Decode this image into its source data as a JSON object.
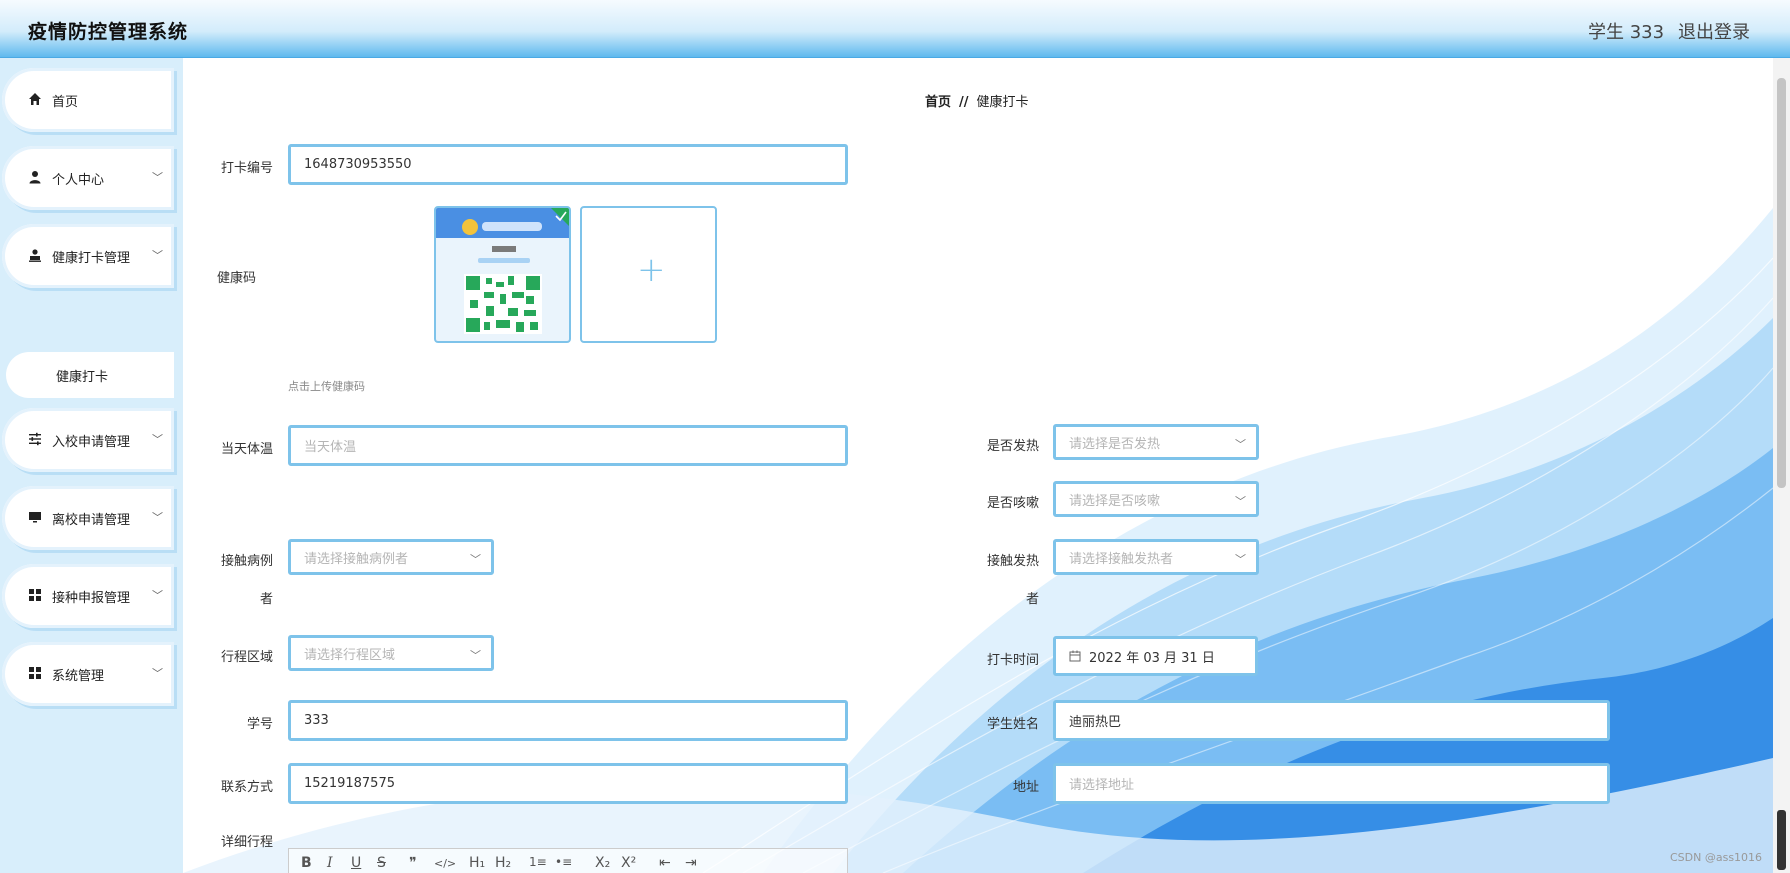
{
  "header": {
    "title": "疫情防控管理系统",
    "user": "学生 333",
    "logout": "退出登录"
  },
  "sidebar": {
    "items": [
      {
        "label": "首页",
        "icon": "home-icon"
      },
      {
        "label": "个人中心",
        "icon": "user-icon",
        "chevron": "﹀"
      },
      {
        "label": "健康打卡管理",
        "icon": "upload-user-icon",
        "chevron": "﹀"
      },
      {
        "label": "入校申请管理",
        "icon": "sliders-icon",
        "chevron": "﹀"
      },
      {
        "label": "离校申请管理",
        "icon": "monitor-icon",
        "chevron": "﹀"
      },
      {
        "label": "接种申报管理",
        "icon": "grid-icon",
        "chevron": "﹀"
      },
      {
        "label": "系统管理",
        "icon": "grid-icon",
        "chevron": "﹀"
      }
    ],
    "sub_item": "健康打卡"
  },
  "breadcrumb": {
    "home": "首页",
    "sep": "//",
    "current": "健康打卡"
  },
  "form": {
    "checkin_no": {
      "label": "打卡编号",
      "value": "1648730953550"
    },
    "health_code": {
      "label": "健康码",
      "hint": "点击上传健康码",
      "plus": "+"
    },
    "temperature": {
      "label": "当天体温",
      "placeholder": "当天体温"
    },
    "fever": {
      "label": "是否发热",
      "placeholder": "请选择是否发热"
    },
    "cough": {
      "label": "是否咳嗽",
      "placeholder": "请选择是否咳嗽"
    },
    "contact_case": {
      "label_1": "接触病例",
      "label_2": "者",
      "placeholder": "请选择接触病例者"
    },
    "contact_fever": {
      "label_1": "接触发热",
      "label_2": "者",
      "placeholder": "请选择接触发热者"
    },
    "region": {
      "label": "行程区域",
      "placeholder": "请选择行程区域"
    },
    "checkin_time": {
      "label": "打卡时间",
      "value": "2022 年 03 月 31 日"
    },
    "student_id": {
      "label": "学号",
      "value": "333"
    },
    "student_name": {
      "label": "学生姓名",
      "value": "迪丽热巴"
    },
    "phone": {
      "label": "联系方式",
      "value": "15219187575"
    },
    "address": {
      "label": "地址",
      "placeholder": "请选择地址"
    },
    "itinerary": {
      "label": "详细行程"
    }
  },
  "editor_toolbar": [
    "B",
    "I",
    "U",
    "S",
    "❞",
    "</>",
    "H₁",
    "H₂",
    "1≡",
    "•≡",
    "X₂",
    "X²",
    "⇤",
    "⇥"
  ],
  "watermark": "CSDN @ass1016",
  "colors": {
    "accent": "#7ec3ea",
    "header_blue": "#5fb9ee",
    "sidebar_bg": "#d8eefb"
  }
}
